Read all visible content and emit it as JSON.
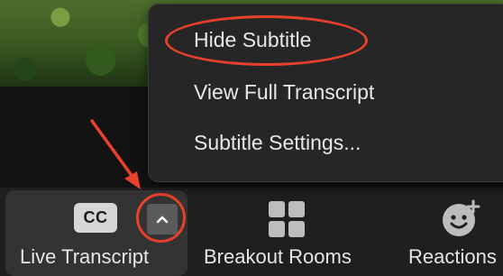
{
  "menu": {
    "items": [
      {
        "label": "Hide Subtitle"
      },
      {
        "label": "View Full Transcript"
      },
      {
        "label": "Subtitle Settings..."
      }
    ]
  },
  "toolbar": {
    "live_transcript": {
      "label": "Live Transcript",
      "cc_text": "CC",
      "icon": "closed-caption-icon"
    },
    "breakout_rooms": {
      "label": "Breakout Rooms",
      "icon": "breakout-rooms-icon"
    },
    "reactions": {
      "label": "Reactions",
      "icon": "emoji-add-icon"
    }
  },
  "colors": {
    "annotation": "#e8412b",
    "menu_bg": "#262626",
    "toolbar_bg": "#1f1f1f"
  }
}
